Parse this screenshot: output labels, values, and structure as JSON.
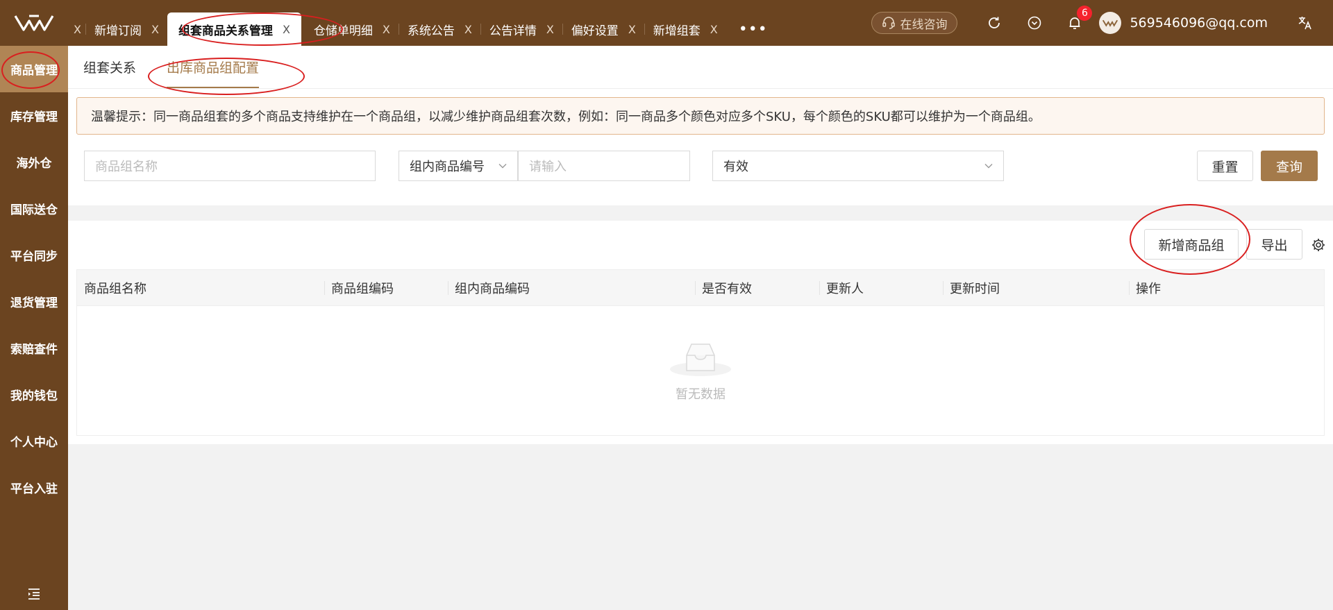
{
  "tabs": [
    {
      "label": "",
      "close": "X"
    },
    {
      "label": "新增订阅",
      "close": "X"
    },
    {
      "label": "组套商品关系管理",
      "close": "X",
      "active": true
    },
    {
      "label": "仓储单明细",
      "close": "X"
    },
    {
      "label": "系统公告",
      "close": "X"
    },
    {
      "label": "公告详情",
      "close": "X"
    },
    {
      "label": "偏好设置",
      "close": "X"
    },
    {
      "label": "新增组套",
      "close": "X"
    }
  ],
  "tab_more": "•••",
  "header": {
    "consult_label": "在线咨询",
    "notification_count": "6",
    "user_email": "569546096@qq.com"
  },
  "sidebar": {
    "items": [
      {
        "label": "商品管理",
        "active": true
      },
      {
        "label": "库存管理"
      },
      {
        "label": "海外仓"
      },
      {
        "label": "国际送仓"
      },
      {
        "label": "平台同步"
      },
      {
        "label": "退货管理"
      },
      {
        "label": "索赔查件"
      },
      {
        "label": "我的钱包"
      },
      {
        "label": "个人中心"
      },
      {
        "label": "平台入驻"
      }
    ]
  },
  "subtabs": [
    {
      "label": "组套关系"
    },
    {
      "label": "出库商品组配置",
      "active": true
    }
  ],
  "tip": "温馨提示：同一商品组套的多个商品支持维护在一个商品组，以减少维护商品组套次数，例如：同一商品多个颜色对应多个SKU，每个颜色的SKU都可以维护为一个商品组。",
  "filters": {
    "group_name_placeholder": "商品组名称",
    "code_type_value": "组内商品编号",
    "code_input_placeholder": "请输入",
    "status_value": "有效",
    "reset_label": "重置",
    "query_label": "查询"
  },
  "toolbar": {
    "add_group_label": "新增商品组",
    "export_label": "导出"
  },
  "table": {
    "columns": [
      "商品组名称",
      "商品组编码",
      "组内商品编码",
      "是否有效",
      "更新人",
      "更新时间",
      "操作"
    ],
    "empty_text": "暂无数据"
  },
  "colors": {
    "brand_dark": "#6b4420",
    "brand_accent": "#a47a4a",
    "sidebar_active": "#b08555",
    "badge": "#f5222d",
    "annotation": "#d91f1f"
  }
}
